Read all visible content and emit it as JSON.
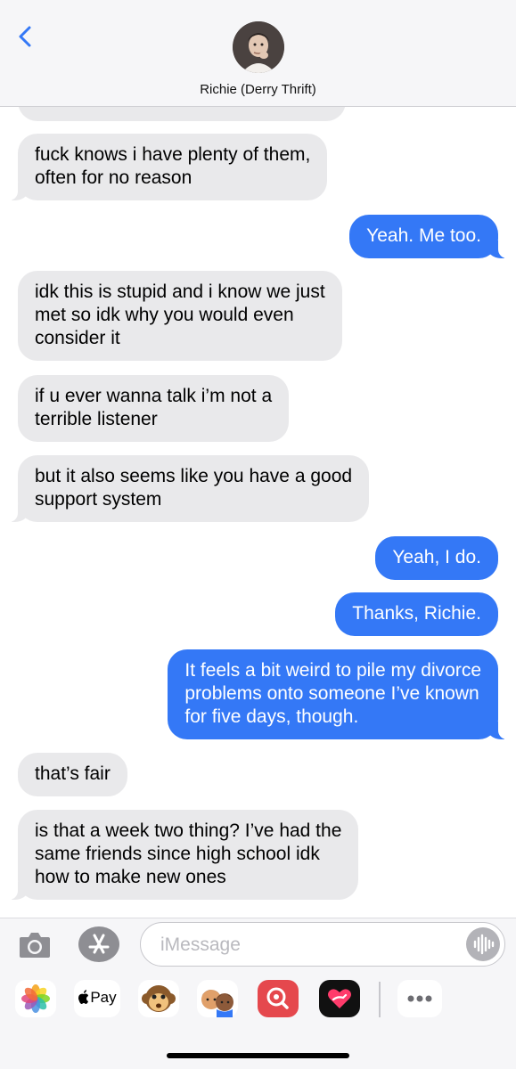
{
  "header": {
    "contact_name": "Richie (Derry Thrift)"
  },
  "messages": [
    {
      "dir": "in",
      "text": "fuck knows i have plenty of them,\noften for no reason"
    },
    {
      "dir": "out",
      "text": "Yeah. Me too."
    },
    {
      "dir": "in",
      "text": "idk this is stupid and i know we just\nmet so idk why you would even\nconsider it"
    },
    {
      "dir": "in",
      "text": "if u ever wanna talk i’m not a\nterrible listener"
    },
    {
      "dir": "in",
      "text": "but it also seems like you have a good\nsupport system"
    },
    {
      "dir": "out",
      "text": "Yeah, I do."
    },
    {
      "dir": "out",
      "text": "Thanks, Richie."
    },
    {
      "dir": "out",
      "text": "It feels a bit weird to pile my divorce\nproblems onto someone I’ve known\nfor five days, though."
    },
    {
      "dir": "in",
      "text": "that’s fair"
    },
    {
      "dir": "in",
      "text": "is that a week two thing? I’ve had the\nsame friends since high school idk\nhow to make new ones"
    }
  ],
  "composer": {
    "placeholder": "iMessage"
  },
  "app_drawer": {
    "apple_pay_label": "Pay",
    "icons": [
      "photos-icon",
      "apple-pay-icon",
      "monkey-emoji-icon",
      "memoji-icon",
      "image-search-icon",
      "digital-touch-icon",
      "more-icon"
    ]
  },
  "colors": {
    "outgoing_bubble": "#3478f6",
    "incoming_bubble": "#e9e9eb",
    "accent": "#3478f6"
  }
}
